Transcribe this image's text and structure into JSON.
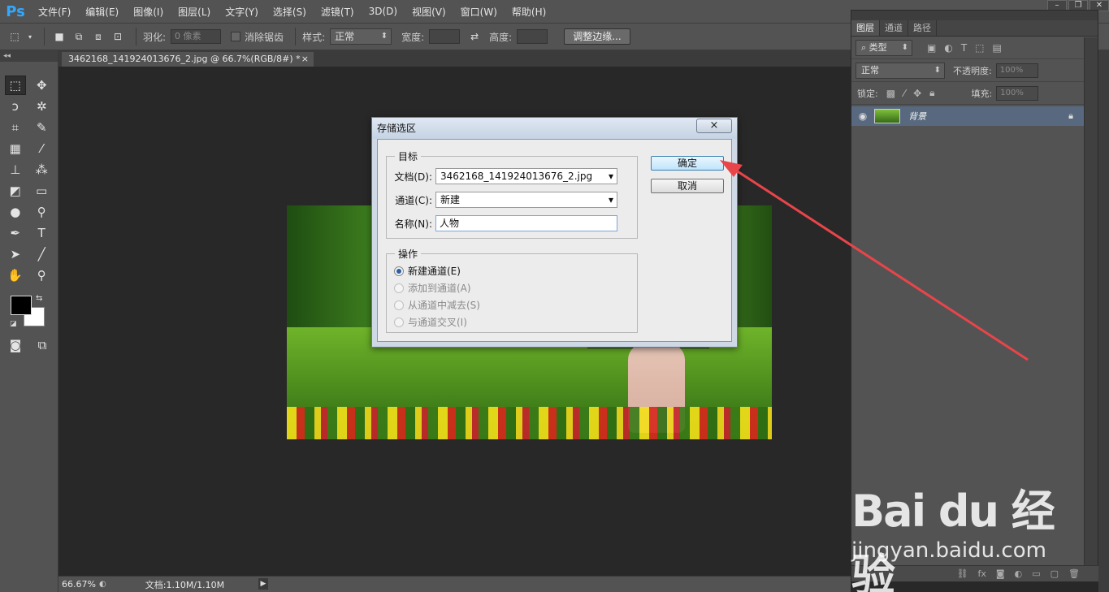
{
  "app": {
    "logo": "Ps",
    "menu": [
      "文件(F)",
      "编辑(E)",
      "图像(I)",
      "图层(L)",
      "文字(Y)",
      "选择(S)",
      "滤镜(T)",
      "3D(D)",
      "视图(V)",
      "窗口(W)",
      "帮助(H)"
    ]
  },
  "options": {
    "feather_label": "羽化:",
    "feather_value": "0 像素",
    "antialias_label": "消除锯齿",
    "style_label": "样式:",
    "style_value": "正常",
    "width_label": "宽度:",
    "height_label": "高度:",
    "refine_button": "调整边缘..."
  },
  "document": {
    "tab_title": "3462168_141924013676_2.jpg @ 66.7%(RGB/8#) *",
    "tab_close": "×"
  },
  "status": {
    "zoom": "66.67%",
    "doc_size": "文档:1.10M/1.10M"
  },
  "layers_panel": {
    "tabs": [
      "图层",
      "通道",
      "路径"
    ],
    "filter_value": "类型",
    "blend_mode": "正常",
    "opacity_label": "不透明度:",
    "opacity_value": "100%",
    "lock_label": "锁定:",
    "fill_label": "填充:",
    "fill_value": "100%",
    "layer_name": "背景"
  },
  "dialog": {
    "title": "存储选区",
    "close": "×",
    "target_legend": "目标",
    "document_label": "文档(D):",
    "document_value": "3462168_141924013676_2.jpg",
    "channel_label": "通道(C):",
    "channel_value": "新建",
    "name_label": "名称(N):",
    "name_value": "人物",
    "operation_legend": "操作",
    "operations": [
      "新建通道(E)",
      "添加到通道(A)",
      "从通道中减去(S)",
      "与通道交叉(I)"
    ],
    "selected_operation": 0,
    "ok_button": "确定",
    "cancel_button": "取消"
  },
  "colors": {
    "annotation_arrow": "#e8454a",
    "layer_selected": "#58697f",
    "foreground": "#000000",
    "background": "#ffffff"
  },
  "watermark": {
    "logo": "Bai du 经验",
    "url": "jingyan.baidu.com"
  }
}
